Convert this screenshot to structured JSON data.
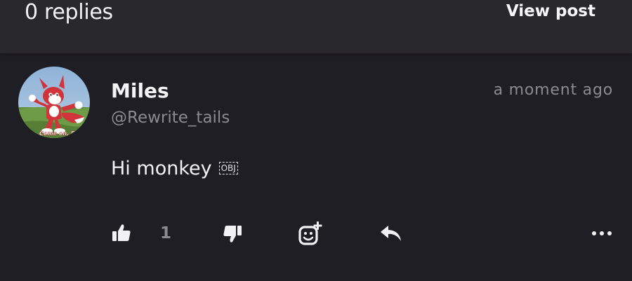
{
  "header": {
    "replies_label": "0 replies",
    "view_post_label": "View post",
    "background": "#29282d"
  },
  "comment": {
    "author_name": "Miles",
    "author_handle": "@Rewrite_tails",
    "timestamp": "a moment ago",
    "message": "Hi monkey",
    "message_glyph": "OBJ",
    "avatar_caption": "Come on, Re",
    "likes_count": "1"
  },
  "actions": {
    "like_icon": "thumbs-up-icon",
    "dislike_icon": "thumbs-down-icon",
    "react_icon": "add-reaction-icon",
    "reply_icon": "reply-arrow-icon",
    "more_icon": "more-horizontal-icon"
  },
  "colors": {
    "background": "#201e25",
    "text_primary": "#f2f2f4",
    "text_secondary": "#8c8a91"
  }
}
